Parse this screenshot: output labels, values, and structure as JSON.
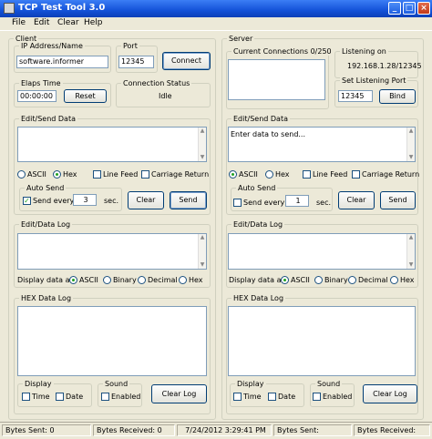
{
  "window": {
    "title": "TCP Test Tool 3.0",
    "controls": {
      "minimize": "_",
      "maximize": "□",
      "close": "×"
    }
  },
  "menu": [
    "File",
    "Edit",
    "Clear",
    "Help"
  ],
  "client": {
    "group_label": "Client",
    "ip_label": "IP Address/Name",
    "ip_value": "software.informer",
    "port_label": "Port",
    "port_value": "12345",
    "connect_label": "Connect",
    "elapsed_label": "Elaps Time",
    "elapsed_value": "00:00:00",
    "reset_label": "Reset",
    "conn_status_label": "Connection Status",
    "conn_status_value": "Idle",
    "edit_send_label": "Edit/Send Data",
    "send_text": "",
    "opt_ascii": "ASCII",
    "opt_hex": "Hex",
    "line_feed": "Line Feed",
    "carriage_return": "Carriage Return",
    "auto_send_label": "Auto Send",
    "send_every": "Send every",
    "interval": "3",
    "sec": "sec.",
    "clear_label": "Clear",
    "send_label": "Send",
    "data_log_label": "Edit/Data Log",
    "display_as": "Display data as:",
    "disp_ascii": "ASCII",
    "disp_binary": "Binary",
    "disp_decimal": "Decimal",
    "disp_hex": "Hex",
    "hex_log_label": "HEX Data Log",
    "display_label": "Display",
    "time_label": "Time",
    "date_label": "Date",
    "sound_label": "Sound",
    "enabled_label": "Enabled",
    "clear_log_label": "Clear Log"
  },
  "server": {
    "group_label": "Server",
    "current_conn_label": "Current Connections 0/250",
    "listening_on_label": "Listening on",
    "listening_on_value": "192.168.1.28/12345",
    "set_port_label": "Set Listening Port",
    "port_value": "12345",
    "bind_label": "Bind",
    "edit_send_label": "Edit/Send Data",
    "send_text": "Enter data to send...",
    "opt_ascii": "ASCII",
    "opt_hex": "Hex",
    "line_feed": "Line Feed",
    "carriage_return": "Carriage Return",
    "auto_send_label": "Auto Send",
    "send_every": "Send every",
    "interval": "1",
    "sec": "sec.",
    "clear_label": "Clear",
    "send_label": "Send",
    "data_log_label": "Edit/Data Log",
    "display_as": "Display data as:",
    "disp_ascii": "ASCII",
    "disp_binary": "Binary",
    "disp_decimal": "Decimal",
    "disp_hex": "Hex",
    "hex_log_label": "HEX Data Log",
    "display_label": "Display",
    "time_label": "Time",
    "date_label": "Date",
    "sound_label": "Sound",
    "enabled_label": "Enabled",
    "clear_log_label": "Clear Log"
  },
  "status": {
    "bytes_sent_client": "Bytes Sent: 0",
    "bytes_received_client": "Bytes Received: 0",
    "datetime": "7/24/2012 3:29:41 PM",
    "bytes_sent_server": "Bytes Sent:",
    "bytes_received_server": "Bytes Received:"
  },
  "colors": {
    "title_bar": "#1452d8",
    "window_bg": "#ece9d8",
    "radio_dot": "#21a121",
    "input_border": "#7f9db9"
  }
}
